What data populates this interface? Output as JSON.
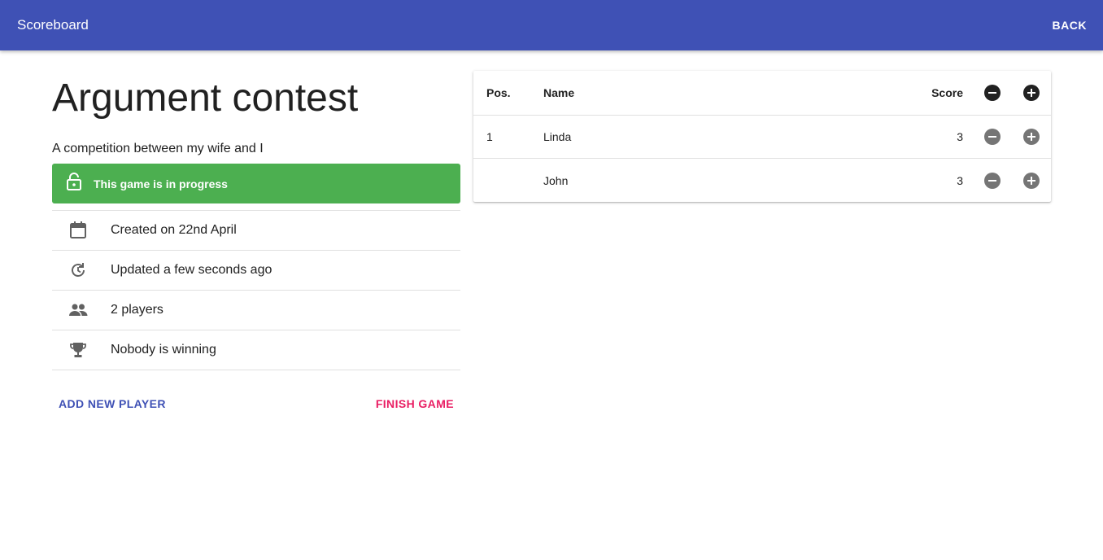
{
  "appbar": {
    "title": "Scoreboard",
    "back_label": "BACK"
  },
  "game": {
    "title": "Argument contest",
    "description": "A competition between my wife and I",
    "status": "This game is in progress",
    "status_color": "#4caf50"
  },
  "info": [
    {
      "icon": "calendar-icon",
      "text": "Created on 22nd April"
    },
    {
      "icon": "history-icon",
      "text": "Updated a few seconds ago"
    },
    {
      "icon": "people-icon",
      "text": "2 players"
    },
    {
      "icon": "trophy-icon",
      "text": "Nobody is winning"
    }
  ],
  "actions": {
    "add_player": "ADD NEW PLAYER",
    "finish_game": "FINISH GAME"
  },
  "table": {
    "headers": {
      "pos": "Pos.",
      "name": "Name",
      "score": "Score"
    },
    "rows": [
      {
        "pos": "1",
        "name": "Linda",
        "score": "3"
      },
      {
        "pos": "",
        "name": "John",
        "score": "3"
      }
    ]
  },
  "colors": {
    "primary": "#3f51b5",
    "accent": "#e91e63",
    "success": "#4caf50"
  }
}
